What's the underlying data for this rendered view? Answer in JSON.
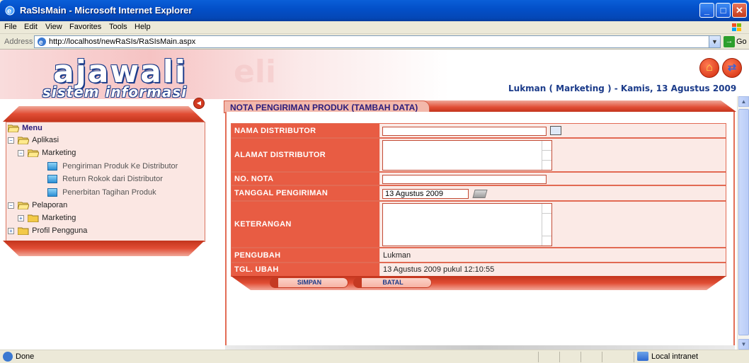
{
  "window": {
    "title": "RaSIsMain - Microsoft Internet Explorer",
    "controls": {
      "minimize": "_",
      "maximize": "□",
      "close": "✕"
    }
  },
  "menubar": {
    "items": [
      "File",
      "Edit",
      "View",
      "Favorites",
      "Tools",
      "Help"
    ]
  },
  "address": {
    "label": "Address",
    "url": "http://localhost/newRaSIs/RaSIsMain.aspx",
    "go": "Go"
  },
  "header": {
    "logo_main": "ajawali",
    "logo_sub": "sistem informasi",
    "user_info": "Lukman ( Marketing ) - Kamis, 13 Agustus 2009",
    "home_icon": "home-icon",
    "exit_icon": "exit-icon"
  },
  "sidebar": {
    "tree": [
      {
        "label": "Menu",
        "level": 0,
        "type": "root"
      },
      {
        "label": "Aplikasi",
        "level": 0,
        "type": "folder-open"
      },
      {
        "label": "Marketing",
        "level": 1,
        "type": "folder-open"
      },
      {
        "label": "Pengiriman Produk Ke Distributor",
        "level": 2,
        "type": "leaf"
      },
      {
        "label": "Return Rokok dari Distributor",
        "level": 2,
        "type": "leaf"
      },
      {
        "label": "Penerbitan Tagihan Produk",
        "level": 2,
        "type": "leaf"
      },
      {
        "label": "Pelaporan",
        "level": 0,
        "type": "folder-open"
      },
      {
        "label": "Marketing",
        "level": 1,
        "type": "folder-closed"
      },
      {
        "label": "Profil Pengguna",
        "level": 0,
        "type": "folder-closed"
      }
    ]
  },
  "main": {
    "title": "NOTA PENGIRIMAN PRODUK (TAMBAH DATA)",
    "fields": {
      "nama_distributor": {
        "label": "NAMA DISTRIBUTOR",
        "value": ""
      },
      "alamat_distributor": {
        "label": "ALAMAT DISTRIBUTOR",
        "value": ""
      },
      "no_nota": {
        "label": "NO. NOTA",
        "value": ""
      },
      "tanggal_pengiriman": {
        "label": "TANGGAL PENGIRIMAN",
        "value": "13 Agustus 2009"
      },
      "keterangan": {
        "label": "KETERANGAN",
        "value": ""
      },
      "pengubah": {
        "label": "PENGUBAH",
        "value": "Lukman"
      },
      "tgl_ubah": {
        "label": "TGL. UBAH",
        "value": "13 Agustus 2009 pukul 12:10:55"
      }
    },
    "buttons": {
      "save": "SIMPAN",
      "cancel": "BATAL"
    }
  },
  "status": {
    "text": "Done",
    "zone": "Local intranet"
  },
  "colors": {
    "accent": "#e85c43",
    "title_bar": "#0350c9",
    "brand_text": "#1b3b8a"
  }
}
